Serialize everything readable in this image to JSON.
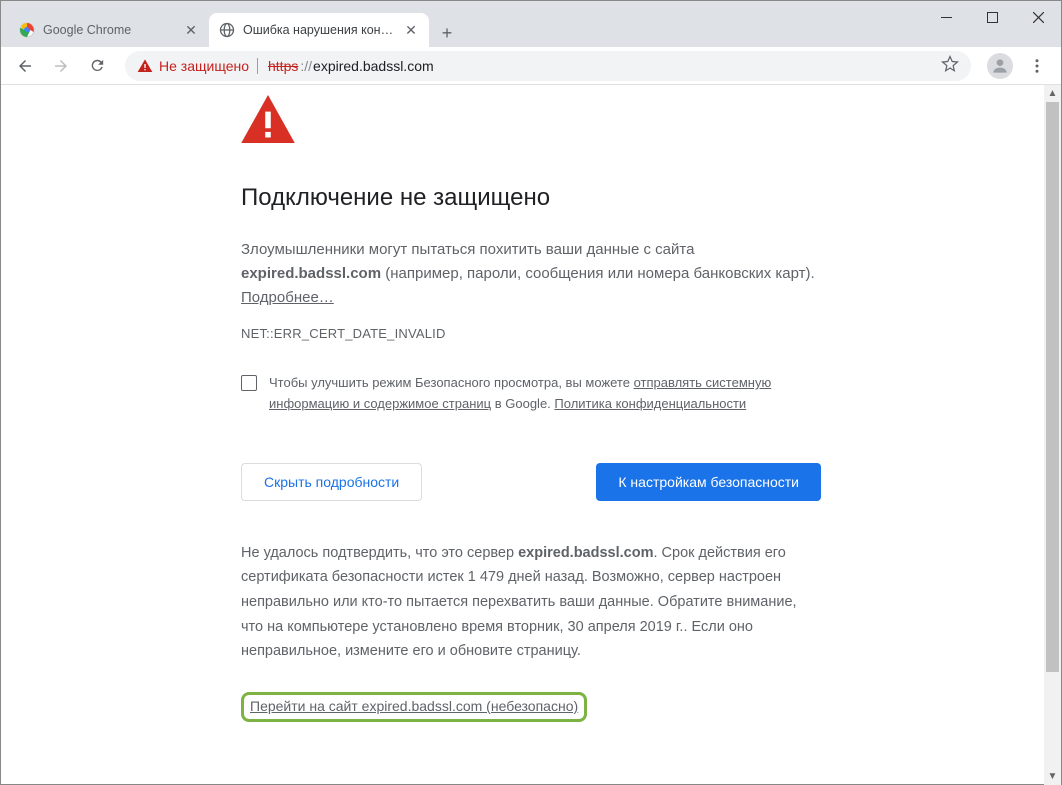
{
  "window": {
    "tabs": [
      {
        "title": "Google Chrome",
        "active": false
      },
      {
        "title": "Ошибка нарушения конфиденц",
        "active": true
      }
    ]
  },
  "toolbar": {
    "security_label": "Не защищено",
    "url_https": "https",
    "url_sep": "://",
    "url_host": "expired.badssl.com"
  },
  "page": {
    "heading": "Подключение не защищено",
    "para1_prefix": "Злоумышленники могут пытаться похитить ваши данные с сайта ",
    "para1_host": "expired.badssl.com",
    "para1_suffix": " (например, пароли, сообщения или номера банковских карт). ",
    "para1_link": "Подробнее…",
    "error_code": "NET::ERR_CERT_DATE_INVALID",
    "checkbox_text_prefix": "Чтобы улучшить режим Безопасного просмотра, вы можете ",
    "checkbox_link1": "отправлять системную информацию и содержимое страниц",
    "checkbox_text_mid": " в Google. ",
    "checkbox_link2": "Политика конфиденциальности",
    "btn_hide": "Скрыть подробности",
    "btn_safety": "К настройкам безопасности",
    "details_prefix": "Не удалось подтвердить, что это сервер ",
    "details_host": "expired.badssl.com",
    "details_body": ". Срок действия его сертификата безопасности истек 1 479 дней назад. Возможно, сервер настроен неправильно или кто-то пытается перехватить ваши данные. Обратите внимание, что на компьютере установлено время вторник, 30 апреля 2019 г.. Если оно неправильное, измените его и обновите страницу.",
    "proceed_link": "Перейти на сайт expired.badssl.com (небезопасно)"
  }
}
